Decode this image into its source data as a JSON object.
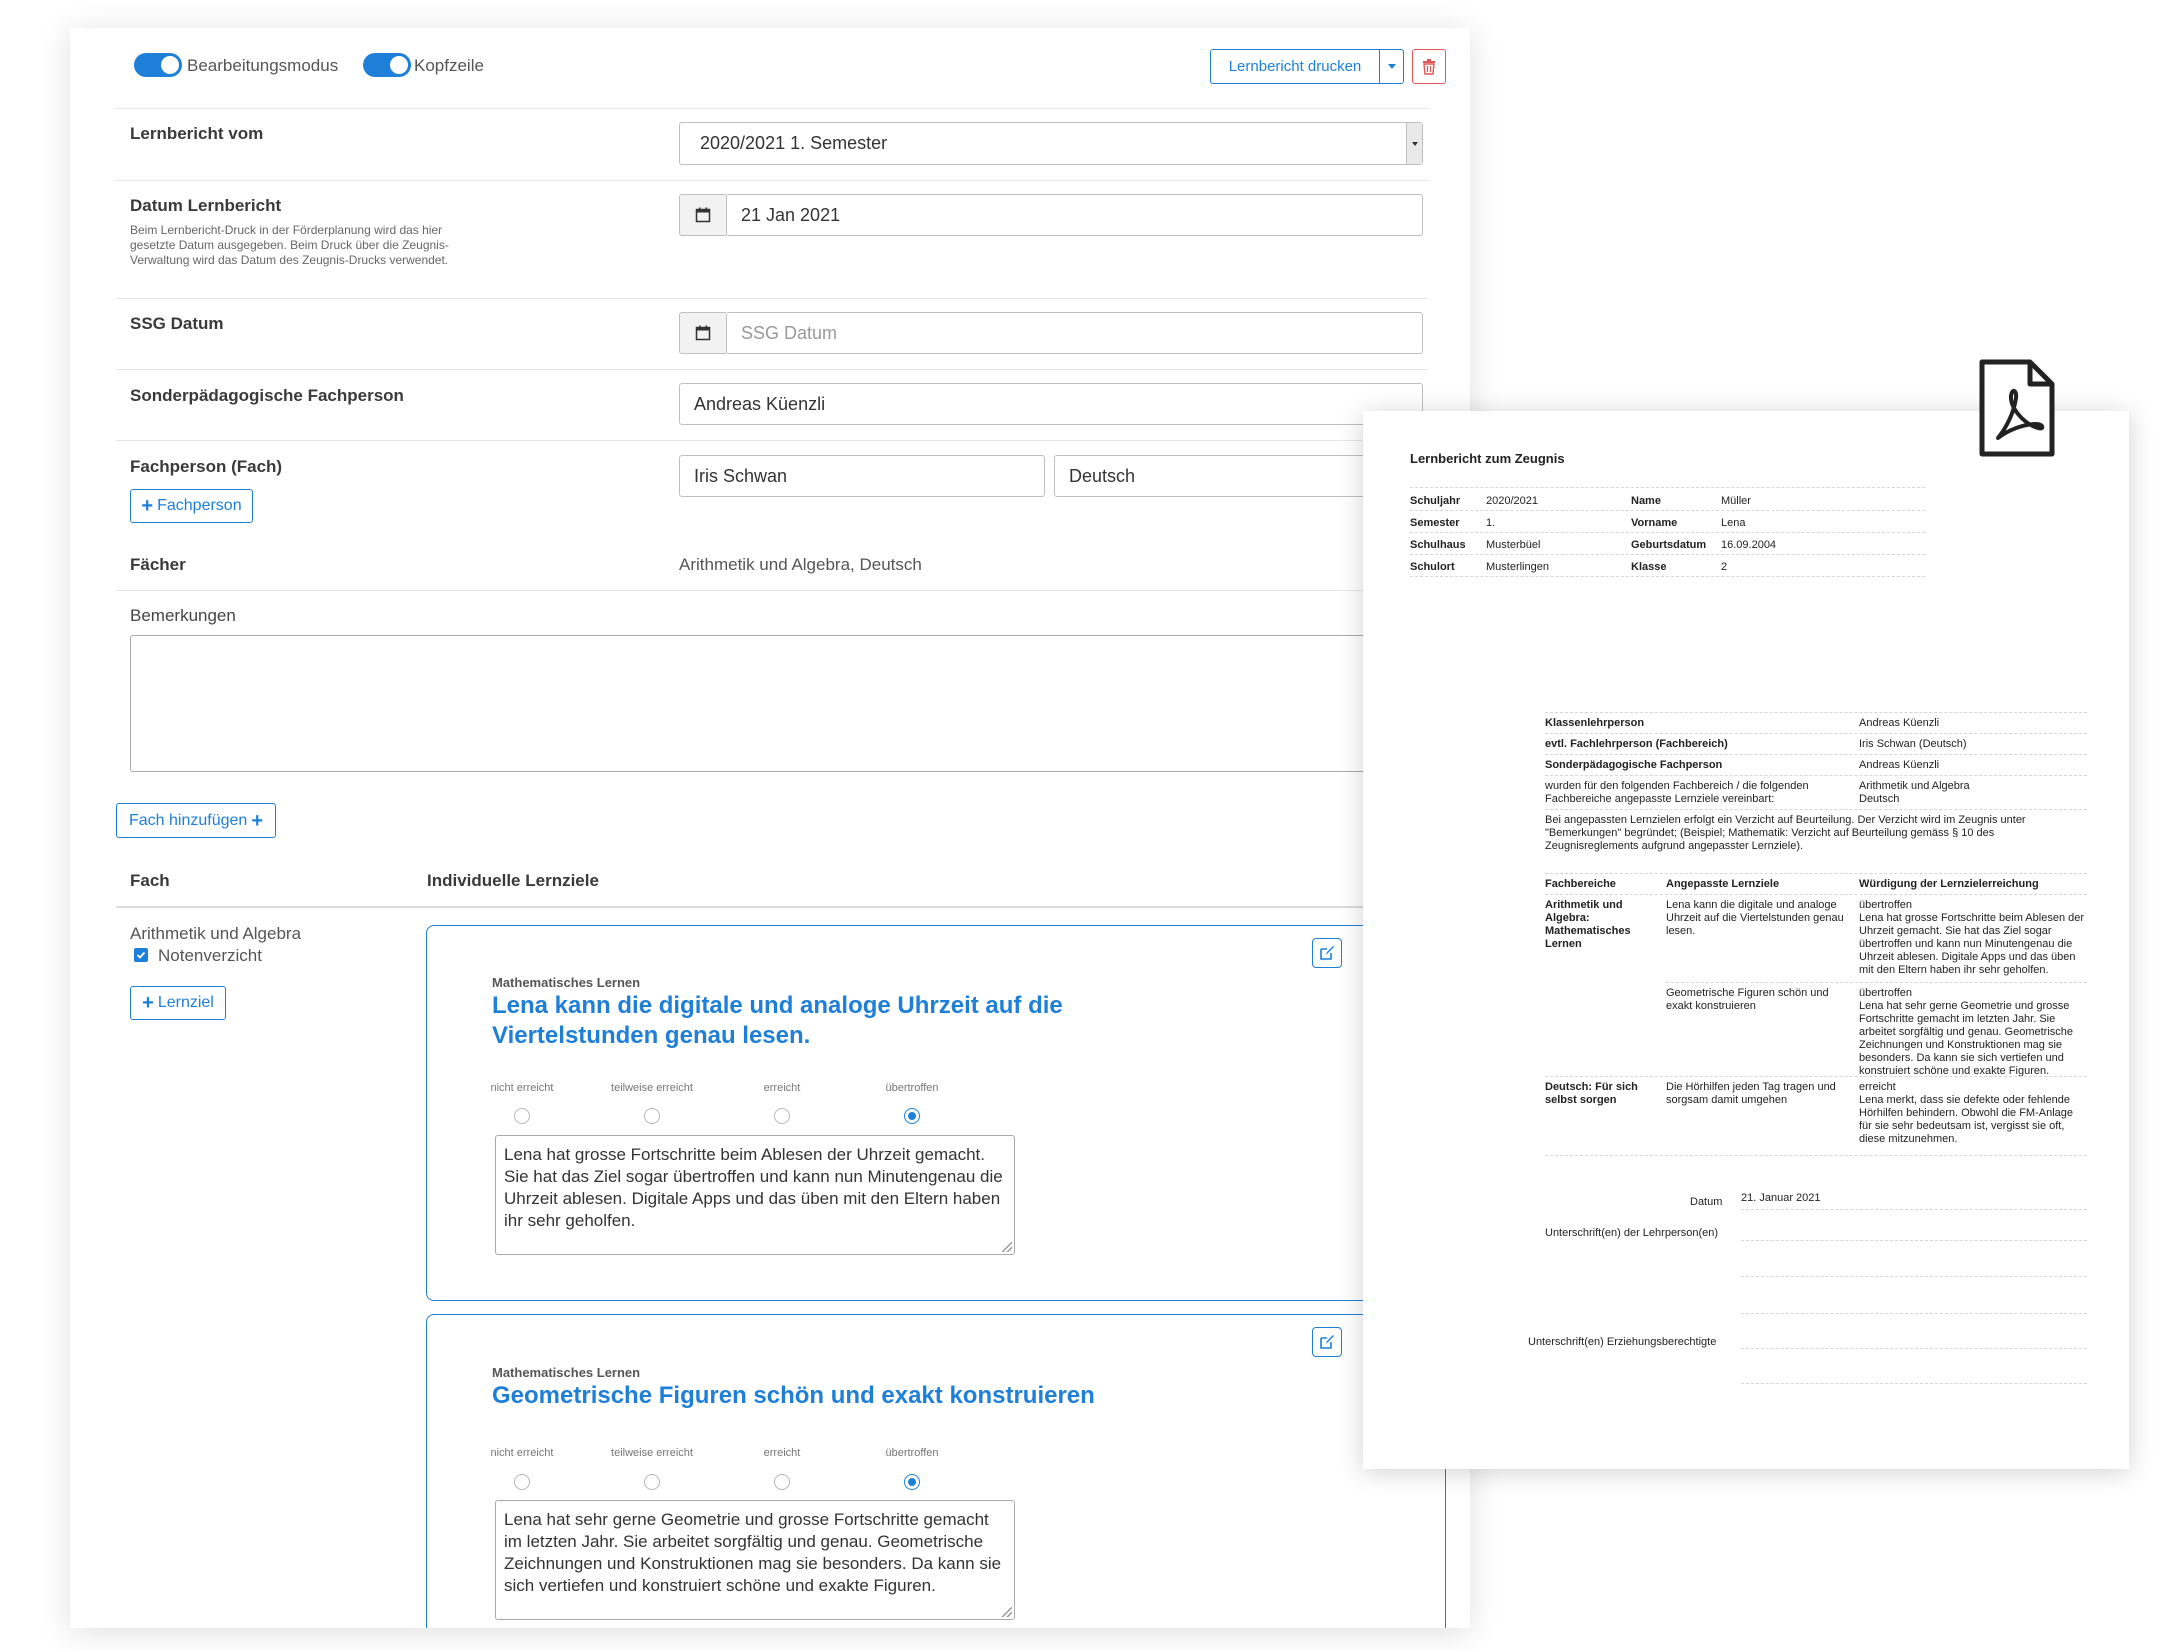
{
  "toolbar": {
    "toggle_edit_label": "Bearbeitungsmodus",
    "toggle_header_label": "Kopfzeile",
    "print_button_label": "Lernbericht drucken"
  },
  "form": {
    "lernbericht_vom": {
      "label": "Lernbericht vom",
      "value": "2020/2021 1. Semester"
    },
    "datum": {
      "label": "Datum Lernbericht",
      "help": "Beim Lernbericht-Druck in der Förderplanung wird das hier gesetzte Datum ausgegeben. Beim Druck über die Zeugnis-Verwaltung wird das Datum des Zeugnis-Drucks verwendet.",
      "value": "21 Jan 2021"
    },
    "ssg": {
      "label": "SSG Datum",
      "placeholder": "SSG Datum"
    },
    "sonder": {
      "label": "Sonderpädagogische Fachperson",
      "value": "Andreas Küenzli"
    },
    "fachperson": {
      "label": "Fachperson (Fach)",
      "name": "Iris Schwan",
      "fach": "Deutsch",
      "add_label": "Fachperson"
    },
    "faecher": {
      "label": "Fächer",
      "value": "Arithmetik und Algebra, Deutsch"
    },
    "bemerkungen": {
      "label": "Bemerkungen"
    },
    "add_fach_label": "Fach hinzufügen"
  },
  "table": {
    "col_fach": "Fach",
    "col_ziele": "Individuelle Lernziele",
    "subject": "Arithmetik und Algebra",
    "noten_label": "Notenverzicht",
    "add_lernziel_label": "Lernziel"
  },
  "ratings": [
    "nicht erreicht",
    "teilweise erreicht",
    "erreicht",
    "übertroffen"
  ],
  "goals": [
    {
      "category": "Mathematisches Lernen",
      "title": "Lena kann die digitale und analoge Uhrzeit auf die Viertelstunden genau lesen.",
      "text": "Lena hat grosse Fortschritte beim Ablesen der Uhrzeit gemacht. Sie hat das Ziel sogar übertroffen und kann nun Minutengenau die Uhrzeit ablesen. Digitale Apps und das üben mit den Eltern haben ihr sehr geholfen."
    },
    {
      "category": "Mathematisches Lernen",
      "title": "Geometrische Figuren schön und exakt konstruieren",
      "text": "Lena hat sehr gerne Geometrie und grosse Fortschritte gemacht im letzten Jahr. Sie arbeitet sorgfältig und genau. Geometrische Zeichnungen und Konstruktionen mag sie besonders. Da kann sie sich vertiefen und konstruiert schöne und exakte Figuren."
    }
  ],
  "pdf": {
    "title": "Lernbericht zum Zeugnis",
    "info": [
      {
        "k1": "Schuljahr",
        "v1": "2020/2021",
        "k2": "Name",
        "v2": "Müller"
      },
      {
        "k1": "Semester",
        "v1": "1.",
        "k2": "Vorname",
        "v2": "Lena"
      },
      {
        "k1": "Schulhaus",
        "v1": "Musterbüel",
        "k2": "Geburtsdatum",
        "v2": "16.09.2004"
      },
      {
        "k1": "Schulort",
        "v1": "Musterlingen",
        "k2": "Klasse",
        "v2": "2"
      }
    ],
    "persons": [
      {
        "k": "Klassenlehrperson",
        "v": "Andreas Küenzli"
      },
      {
        "k": "evtl. Fachlehrperson (Fachbereich)",
        "v": "Iris Schwan (Deutsch)"
      },
      {
        "k": "Sonderpädagogische Fachperson",
        "v": "Andreas Küenzli"
      }
    ],
    "agreed_text": "wurden für den folgenden Fachbereich / die folgenden Fachbereiche angepasste Lernziele vereinbart:",
    "agreed_value_1": "Arithmetik und Algebra",
    "agreed_value_2": "Deutsch",
    "note": "Bei angepassten Lernzielen erfolgt ein Verzicht auf Beurteilung. Der Verzicht wird im Zeugnis unter \"Bemerkungen\" begründet; (Beispiel; Mathematik: Verzicht auf Beurteilung gemäss § 10 des Zeugnisreglements aufgrund angepasster Lernziele).",
    "th1": "Fachbereiche",
    "th2": "Angepasste Lernziele",
    "th3": "Würdigung der Lernzielerreichung",
    "r1_area": "Arithmetik und Algebra: Mathematisches Lernen",
    "r1_goal": "Lena kann die digitale und analoge Uhrzeit auf die Viertelstunden genau lesen.",
    "r1_status": "übertroffen",
    "r1_text": "Lena hat grosse Fortschritte beim Ablesen der Uhrzeit gemacht. Sie hat das Ziel sogar übertroffen und kann nun Minutengenau die Uhrzeit ablesen. Digitale Apps und das üben mit den Eltern haben ihr sehr geholfen.",
    "r2_goal": "Geometrische Figuren schön und exakt konstruieren",
    "r2_status": "übertroffen",
    "r2_text": "Lena hat sehr gerne Geometrie und grosse Fortschritte gemacht im letzten Jahr. Sie arbeitet sorgfältig und genau. Geometrische Zeichnungen und Konstruktionen mag sie besonders. Da kann sie sich vertiefen und konstruiert schöne und exakte Figuren.",
    "r3_area": "Deutsch: Für sich selbst sorgen",
    "r3_goal": "Die Hörhilfen jeden Tag tragen und sorgsam damit umgehen",
    "r3_status": "erreicht",
    "r3_text": "Lena merkt, dass sie defekte oder fehlende Hörhilfen behindern. Obwohl die FM-Anlage für sie sehr bedeutsam ist, vergisst sie oft, diese mitzunehmen.",
    "datum_label": "Datum",
    "datum_value": "21. Januar 2021",
    "sig_teacher": "Unterschrift(en) der Lehrperson(en)",
    "sig_parents": "Unterschrift(en) Erziehungsberechtigte"
  },
  "colors": {
    "accent": "#1e7fd9",
    "danger": "#e05555"
  }
}
